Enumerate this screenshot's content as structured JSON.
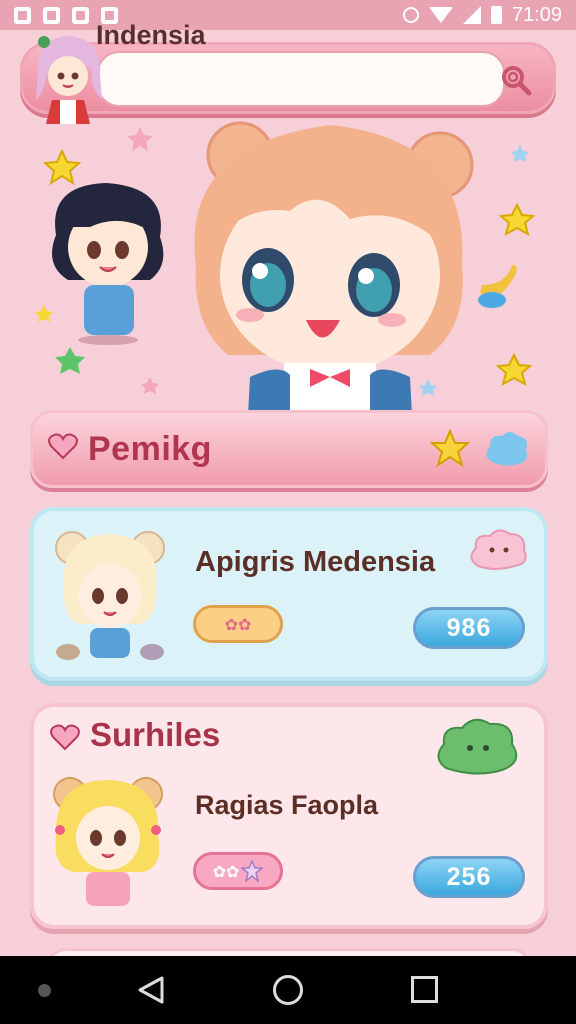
{
  "status_bar": {
    "time": "71:09"
  },
  "search": {
    "value": "Indensia"
  },
  "banner": {
    "title": "Pemikg"
  },
  "cards": [
    {
      "name": "Apigris Medensia",
      "stat": "986",
      "badge": "✿✿"
    },
    {
      "section": "Surhiles",
      "name": "Ragias Faopla",
      "stat": "256",
      "badge": "✿✿"
    }
  ],
  "colors": {
    "background": "#f6cfd8",
    "accent_pink": "#ec8ea2",
    "accent_blue": "#3ba8de",
    "title_red": "#b2354f"
  },
  "icons": {
    "search": "search-icon",
    "heart": "heart-icon",
    "star": "star-icon",
    "cloud": "cloud-icon"
  }
}
